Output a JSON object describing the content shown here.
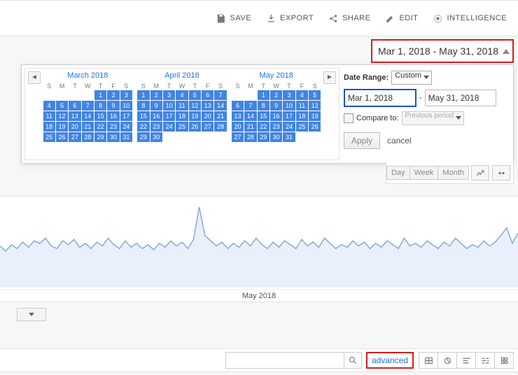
{
  "toolbar": {
    "save": "SAVE",
    "export": "EXPORT",
    "share": "SHARE",
    "edit": "EDIT",
    "intelligence": "INTELLIGENCE"
  },
  "date_range": {
    "display": "Mar 1, 2018 - May 31, 2018",
    "label": "Date Range:",
    "select_value": "Custom",
    "start": "Mar 1, 2018",
    "end": "May 31, 2018",
    "compare_label": "Compare to:",
    "compare_value": "Previous period",
    "apply": "Apply",
    "cancel": "cancel"
  },
  "calendar": {
    "dow": [
      "S",
      "M",
      "T",
      "W",
      "T",
      "F",
      "S"
    ],
    "months": [
      {
        "title": "March 2018",
        "start_dow": 4,
        "days": 31
      },
      {
        "title": "April 2018",
        "start_dow": 0,
        "days": 30
      },
      {
        "title": "May 2018",
        "start_dow": 2,
        "days": 31
      }
    ]
  },
  "granularity": {
    "day": "Day",
    "week": "Week",
    "month": "Month"
  },
  "chart_data": {
    "type": "line",
    "title": "",
    "xlabel": "May 2018",
    "ylabel": "",
    "x": [
      0,
      1,
      2,
      3,
      4,
      5,
      6,
      7,
      8,
      9,
      10,
      11,
      12,
      13,
      14,
      15,
      16,
      17,
      18,
      19,
      20,
      21,
      22,
      23,
      24,
      25,
      26,
      27,
      28,
      29,
      30,
      31,
      32,
      33,
      34,
      35,
      36,
      37,
      38,
      39,
      40,
      41,
      42,
      43,
      44,
      45,
      46,
      47,
      48,
      49,
      50,
      51,
      52,
      53,
      54,
      55,
      56,
      57,
      58,
      59,
      60,
      61,
      62,
      63,
      64,
      65,
      66,
      67,
      68,
      69,
      70,
      71,
      72,
      73,
      74,
      75,
      76,
      77,
      78,
      79,
      80,
      81,
      82,
      83,
      84,
      85,
      86,
      87,
      88,
      89,
      90,
      91
    ],
    "values": [
      32,
      28,
      33,
      30,
      35,
      31,
      36,
      34,
      38,
      32,
      30,
      36,
      33,
      37,
      31,
      34,
      30,
      35,
      32,
      38,
      33,
      30,
      36,
      31,
      34,
      30,
      33,
      29,
      34,
      31,
      36,
      32,
      35,
      30,
      37,
      62,
      40,
      36,
      32,
      35,
      30,
      34,
      31,
      36,
      32,
      38,
      33,
      30,
      35,
      31,
      36,
      33,
      30,
      37,
      32,
      35,
      31,
      38,
      34,
      30,
      33,
      31,
      36,
      32,
      35,
      30,
      34,
      31,
      36,
      33,
      30,
      38,
      32,
      34,
      31,
      36,
      33,
      30,
      35,
      32,
      38,
      34,
      30,
      33,
      31,
      36,
      32,
      35,
      40,
      46,
      34,
      42
    ],
    "ylim": [
      0,
      70
    ]
  },
  "search": {
    "placeholder": "",
    "advanced": "advanced"
  }
}
